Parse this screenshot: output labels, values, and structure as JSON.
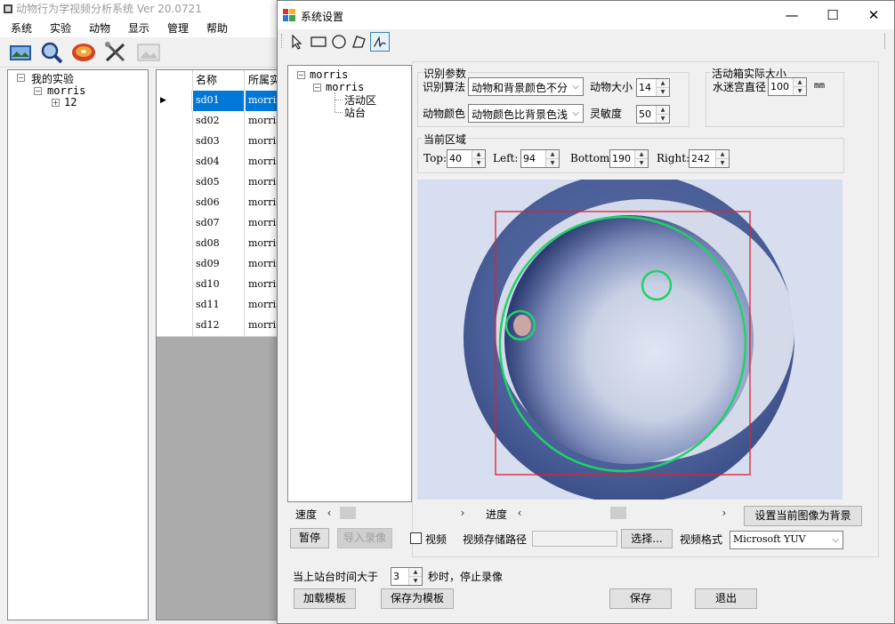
{
  "background_app": {
    "title": "动物行为学视频分析系统 Ver 20.0721",
    "menu": [
      "系统",
      "实验",
      "动物",
      "显示",
      "管理",
      "帮助"
    ],
    "toolbar_icons": [
      "video-icon",
      "search-icon",
      "disc-icon",
      "tools-icon",
      "image-icon"
    ],
    "tree": {
      "root": "我的实验",
      "child": "morris",
      "grandchild": "12"
    },
    "grid": {
      "headers": [
        "名称",
        "所属实"
      ],
      "rows": [
        {
          "name": "sd01",
          "exp": "morris"
        },
        {
          "name": "sd02",
          "exp": "morris"
        },
        {
          "name": "sd03",
          "exp": "morris"
        },
        {
          "name": "sd04",
          "exp": "morris"
        },
        {
          "name": "sd05",
          "exp": "morris"
        },
        {
          "name": "sd06",
          "exp": "morris"
        },
        {
          "name": "sd07",
          "exp": "morris"
        },
        {
          "name": "sd08",
          "exp": "morris"
        },
        {
          "name": "sd09",
          "exp": "morris"
        },
        {
          "name": "sd10",
          "exp": "morris"
        },
        {
          "name": "sd11",
          "exp": "morris"
        },
        {
          "name": "sd12",
          "exp": "morris"
        }
      ],
      "selected_index": 0
    }
  },
  "dialog": {
    "title": "系统设置",
    "caption_buttons": {
      "minimize": "—",
      "maximize": "☐",
      "close": "✕"
    },
    "tools": [
      "pointer-tool",
      "rectangle-tool",
      "circle-tool",
      "polygon-tool",
      "curve-tool"
    ],
    "tree": {
      "root": "morris",
      "child": "morris",
      "leaves": [
        "活动区",
        "站台"
      ]
    },
    "recognition": {
      "group_label": "识别参数",
      "algorithm_label": "识别算法",
      "algorithm_value": "动物和背景颜色不分",
      "size_label": "动物大小",
      "size_value": "14",
      "color_label": "动物颜色",
      "color_value": "动物颜色比背景色浅",
      "sensitivity_label": "灵敏度",
      "sensitivity_value": "50"
    },
    "box_size": {
      "group_label": "活动箱实际大小",
      "diameter_label": "水迷宫直径",
      "diameter_value": "100",
      "unit": "mm"
    },
    "region": {
      "group_label": "当前区域",
      "top_label": "Top:",
      "top_value": "40",
      "left_label": "Left:",
      "left_value": "94",
      "bottom_label": "Bottom:",
      "bottom_value": "190",
      "right_label": "Right:",
      "right_value": "242"
    },
    "speed_label": "速度",
    "progress_label": "进度",
    "speed_level": 0.05,
    "progress_level": 0.48,
    "set_background_button": "设置当前图像为背景",
    "pause_button": "暂停",
    "import_button": "导入录像",
    "video_checkbox_label": "视频",
    "video_checked": false,
    "video_path_label": "视频存储路径",
    "video_path_value": "",
    "choose_button": "选择...",
    "video_format_label": "视频格式",
    "video_format_value": "Microsoft YUV",
    "stop_text_prefix": "当上站台时间大于",
    "stop_seconds": "3",
    "stop_text_suffix": "秒时，停止录像",
    "load_template_button": "加载模板",
    "save_template_button": "保存为模板",
    "save_button": "保存",
    "exit_button": "退出",
    "colors": {
      "roi_rect": "#e02030",
      "zone_circle": "#22d06a",
      "selection": "#0078d7"
    }
  }
}
